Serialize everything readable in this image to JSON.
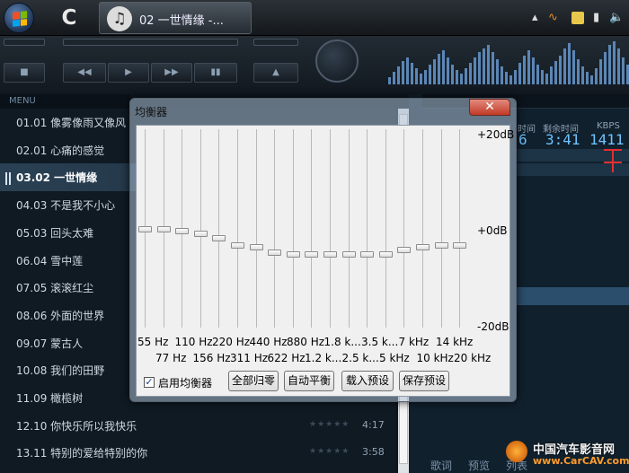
{
  "taskbar": {
    "window_title": "02 一世情缘 -...",
    "icons": [
      "windows-start-icon",
      "c-app-icon",
      "ttplayer-icon"
    ],
    "tray_icons": [
      "sound-icon",
      "network-icon",
      "battery-icon",
      "speaker-icon"
    ]
  },
  "player": {
    "menu_label": "MENU",
    "buttons": [
      "stop",
      "previous",
      "play",
      "next",
      "eject"
    ],
    "info": {
      "elapsed_label": "时间",
      "remaining_label": "剩余时间",
      "kbps_label": "KBPS",
      "elapsed_value": "6",
      "remaining_value": "3:41",
      "kbps_value": "1411"
    }
  },
  "playlist": {
    "items": [
      {
        "text": "01.01 像雾像雨又像风",
        "stars": "",
        "duration": ""
      },
      {
        "text": "02.01 心痛的感觉",
        "stars": "",
        "duration": ""
      },
      {
        "text": "03.02 一世情缘",
        "stars": "",
        "duration": ""
      },
      {
        "text": "04.03 不是我不小心",
        "stars": "",
        "duration": ""
      },
      {
        "text": "05.03 回头太难",
        "stars": "",
        "duration": ""
      },
      {
        "text": "06.04 雪中莲",
        "stars": "",
        "duration": ""
      },
      {
        "text": "07.05 滚滚红尘",
        "stars": "",
        "duration": ""
      },
      {
        "text": "08.06 外面的世界",
        "stars": "",
        "duration": ""
      },
      {
        "text": "09.07 蒙古人",
        "stars": "",
        "duration": ""
      },
      {
        "text": "10.08 我们的田野",
        "stars": "",
        "duration": ""
      },
      {
        "text": "11.09 橄榄树",
        "stars": "",
        "duration": ""
      },
      {
        "text": "12.10 你快乐所以我快乐",
        "stars": "★★★★★",
        "duration": "4:17"
      },
      {
        "text": "13.11 特别的爱给特别的你",
        "stars": "★★★★★",
        "duration": "3:58"
      }
    ],
    "active_index": 2
  },
  "right_tabs": [
    "歌词",
    "预览",
    "列表"
  ],
  "watermark": {
    "cn": "中国汽车影音网",
    "url": "www.CarCAV.com"
  },
  "equalizer": {
    "title": "均衡器",
    "close_icon": "close-icon",
    "db_labels": [
      "+20dB",
      "+0dB",
      "-20dB"
    ],
    "db_range": [
      -20,
      20
    ],
    "bands": [
      {
        "freq": "55 Hz",
        "gain_db": 0
      },
      {
        "freq": "77 Hz",
        "gain_db": 0
      },
      {
        "freq": "110 Hz",
        "gain_db": -0.5
      },
      {
        "freq": "156 Hz",
        "gain_db": -1
      },
      {
        "freq": "220 Hz",
        "gain_db": -2
      },
      {
        "freq": "311 Hz",
        "gain_db": -3.5
      },
      {
        "freq": "440 Hz",
        "gain_db": -4
      },
      {
        "freq": "622 Hz",
        "gain_db": -5
      },
      {
        "freq": "880 Hz",
        "gain_db": -5.5
      },
      {
        "freq": "1.2 k...",
        "gain_db": -5.5
      },
      {
        "freq": "1.8 k...",
        "gain_db": -5.5
      },
      {
        "freq": "2.5 k...",
        "gain_db": -5.5
      },
      {
        "freq": "3.5 k...",
        "gain_db": -5.5
      },
      {
        "freq": "5 kHz",
        "gain_db": -5.5
      },
      {
        "freq": "7 kHz",
        "gain_db": -4.5
      },
      {
        "freq": "10 kHz",
        "gain_db": -4
      },
      {
        "freq": "14 kHz",
        "gain_db": -3.5
      },
      {
        "freq": "20 kHz",
        "gain_db": -3.5
      }
    ],
    "enable_label": "启用均衡器",
    "enabled": true,
    "buttons": [
      "全部归零",
      "自动平衡",
      "载入预设",
      "保存预设"
    ]
  }
}
